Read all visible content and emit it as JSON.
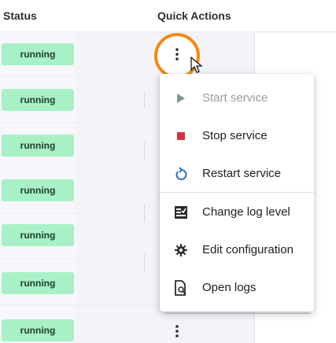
{
  "table": {
    "headers": {
      "status": "Status",
      "quick_actions": "Quick Actions"
    },
    "rows": [
      {
        "status": "running"
      },
      {
        "status": "running"
      },
      {
        "status": "running"
      },
      {
        "status": "running"
      },
      {
        "status": "running"
      },
      {
        "status": "running"
      },
      {
        "status": "running"
      }
    ]
  },
  "menu": {
    "items": [
      {
        "label": "Start service",
        "icon": "play-icon",
        "enabled": false
      },
      {
        "label": "Stop service",
        "icon": "stop-icon",
        "enabled": true
      },
      {
        "label": "Restart service",
        "icon": "restart-icon",
        "enabled": true
      },
      {
        "label": "Change log level",
        "icon": "log-level-icon",
        "enabled": true
      },
      {
        "label": "Edit configuration",
        "icon": "gear-icon",
        "enabled": true
      },
      {
        "label": "Open logs",
        "icon": "open-logs-icon",
        "enabled": true
      }
    ]
  },
  "colors": {
    "status_badge_bg": "#a8f0c6",
    "highlight_ring": "#f28a10",
    "play_icon": "#7f9a8a",
    "stop_icon": "#d3323a",
    "restart_icon": "#2c6bd6"
  }
}
